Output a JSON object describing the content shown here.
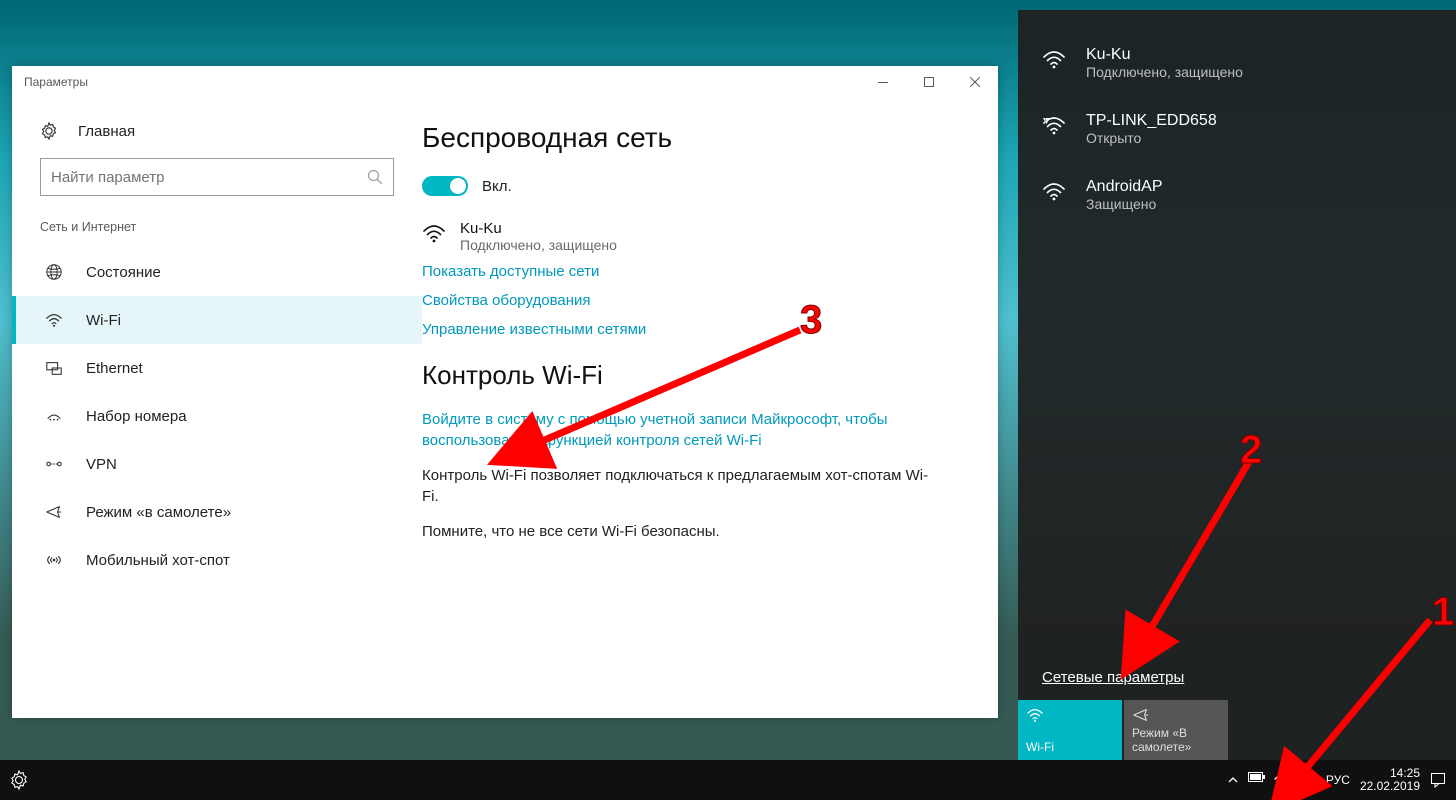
{
  "settings": {
    "title": "Параметры",
    "home": "Главная",
    "search_placeholder": "Найти параметр",
    "section": "Сеть и Интернет",
    "nav": {
      "status": "Состояние",
      "wifi": "Wi-Fi",
      "ethernet": "Ethernet",
      "dialup": "Набор номера",
      "vpn": "VPN",
      "airplane": "Режим «в самолете»",
      "hotspot": "Мобильный хот-спот"
    }
  },
  "content": {
    "h1": "Беспроводная сеть",
    "toggle_label": "Вкл.",
    "connected_name": "Ku-Ku",
    "connected_sub": "Подключено, защищено",
    "show_available": "Показать доступные сети",
    "hw_props": "Свойства оборудования",
    "manage_known": "Управление известными сетями",
    "h2": "Контроль Wi-Fi",
    "signin": "Войдите в систему с помощью учетной записи Майкрософт, чтобы воспользоваться функцией контроля сетей Wi-Fi",
    "p1": "Контроль Wi-Fi позволяет подключаться к предлагаемым хот-спотам Wi-Fi.",
    "p2": "Помните, что не все сети Wi-Fi безопасны."
  },
  "flyout": {
    "n1": {
      "name": "Ku-Ku",
      "sub": "Подключено, защищено"
    },
    "n2": {
      "name": "TP-LINK_EDD658",
      "sub": "Открыто"
    },
    "n3": {
      "name": "AndroidAP",
      "sub": "Защищено"
    },
    "settings_link": "Сетевые параметры",
    "tile_wifi": "Wi-Fi",
    "tile_airplane": "Режим «В самолете»"
  },
  "taskbar": {
    "lang": "РУС",
    "time": "14:25",
    "date": "22.02.2019"
  },
  "annotations": {
    "n1": "1",
    "n2": "2",
    "n3": "3"
  }
}
